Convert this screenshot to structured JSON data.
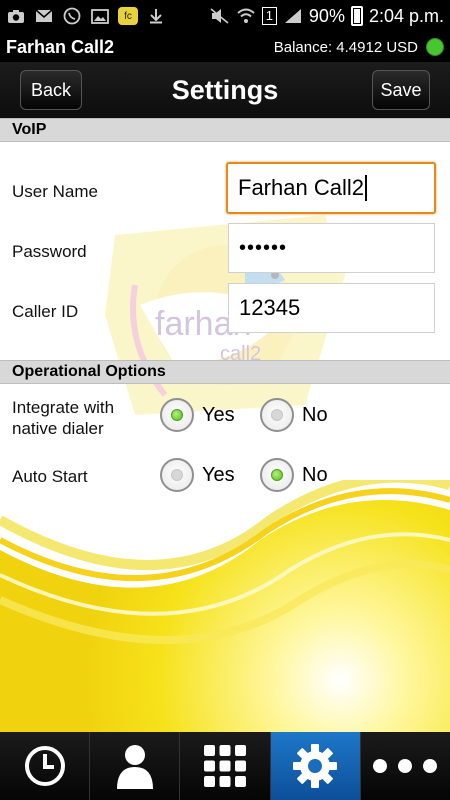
{
  "status_bar": {
    "battery": "90%",
    "time": "2:04 p.m.",
    "sim_slot": "1"
  },
  "app": {
    "name": "Farhan Call2",
    "balance": "Balance: 4.4912 USD",
    "status_color": "#47c62f"
  },
  "header": {
    "back_label": "Back",
    "title": "Settings",
    "save_label": "Save"
  },
  "voip": {
    "section_title": "VoIP",
    "user_name_label": "User Name",
    "user_name_value": "Farhan Call2",
    "password_label": "Password",
    "password_value": "••••••",
    "caller_id_label": "Caller ID",
    "caller_id_value": "12345"
  },
  "operational": {
    "section_title": "Operational Options",
    "integrate": {
      "label_line1": "Integrate with",
      "label_line2": "native dialer",
      "yes_label": "Yes",
      "no_label": "No",
      "selected": "yes"
    },
    "auto_start": {
      "label": "Auto Start",
      "yes_label": "Yes",
      "no_label": "No",
      "selected": "no"
    }
  },
  "bottom_nav": {
    "items": [
      {
        "icon": "clock-icon",
        "name": "history"
      },
      {
        "icon": "person-icon",
        "name": "contacts"
      },
      {
        "icon": "dialpad-icon",
        "name": "dialpad"
      },
      {
        "icon": "gear-icon",
        "name": "settings",
        "active": true
      },
      {
        "icon": "more-icon",
        "name": "more"
      }
    ],
    "active_color": "#1d77c8"
  },
  "colors": {
    "accent_orange": "#e48a1b",
    "radio_green": "#4fbd16",
    "background_yellow": "#f4e21a"
  }
}
